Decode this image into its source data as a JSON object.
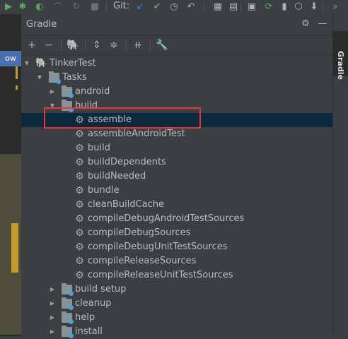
{
  "toolbar": {
    "git_label": "Git:",
    "icons": [
      "debug-icon",
      "profile-icon",
      "attach-icon",
      "stop-icon",
      "git-update-icon",
      "git-commit-icon",
      "history-icon",
      "rollback-icon",
      "structure-icon",
      "run-icon",
      "gradle-sync-icon",
      "avd-icon",
      "sdk-icon",
      "search-icon"
    ]
  },
  "editor": {
    "tab_fragment": "ow"
  },
  "panel": {
    "title": "Gradle",
    "header_icons": [
      "settings-icon",
      "minimize-icon"
    ],
    "toolbar_icons": [
      "add-icon",
      "remove-icon",
      "gradle-elephant-icon",
      "expand-all-icon",
      "collapse-all-icon",
      "link-icon",
      "wrench-icon"
    ]
  },
  "tree": {
    "root": "TinkerTest",
    "tasks": "Tasks",
    "android": "android",
    "build": "build",
    "build_tasks": [
      "assemble",
      "assembleAndroidTest",
      "build",
      "buildDependents",
      "buildNeeded",
      "bundle",
      "cleanBuildCache",
      "compileDebugAndroidTestSources",
      "compileDebugSources",
      "compileDebugUnitTestSources",
      "compileReleaseSources",
      "compileReleaseUnitTestSources"
    ],
    "groups_after": [
      "build setup",
      "cleanup",
      "help",
      "install"
    ],
    "selected": "assemble"
  },
  "side_tab": {
    "label": "Gradle"
  },
  "colors": {
    "selection": "#0d293e",
    "highlight_border": "#e8373b",
    "panel_bg": "#3c3f41",
    "task_badge": "#4e9fd6"
  }
}
